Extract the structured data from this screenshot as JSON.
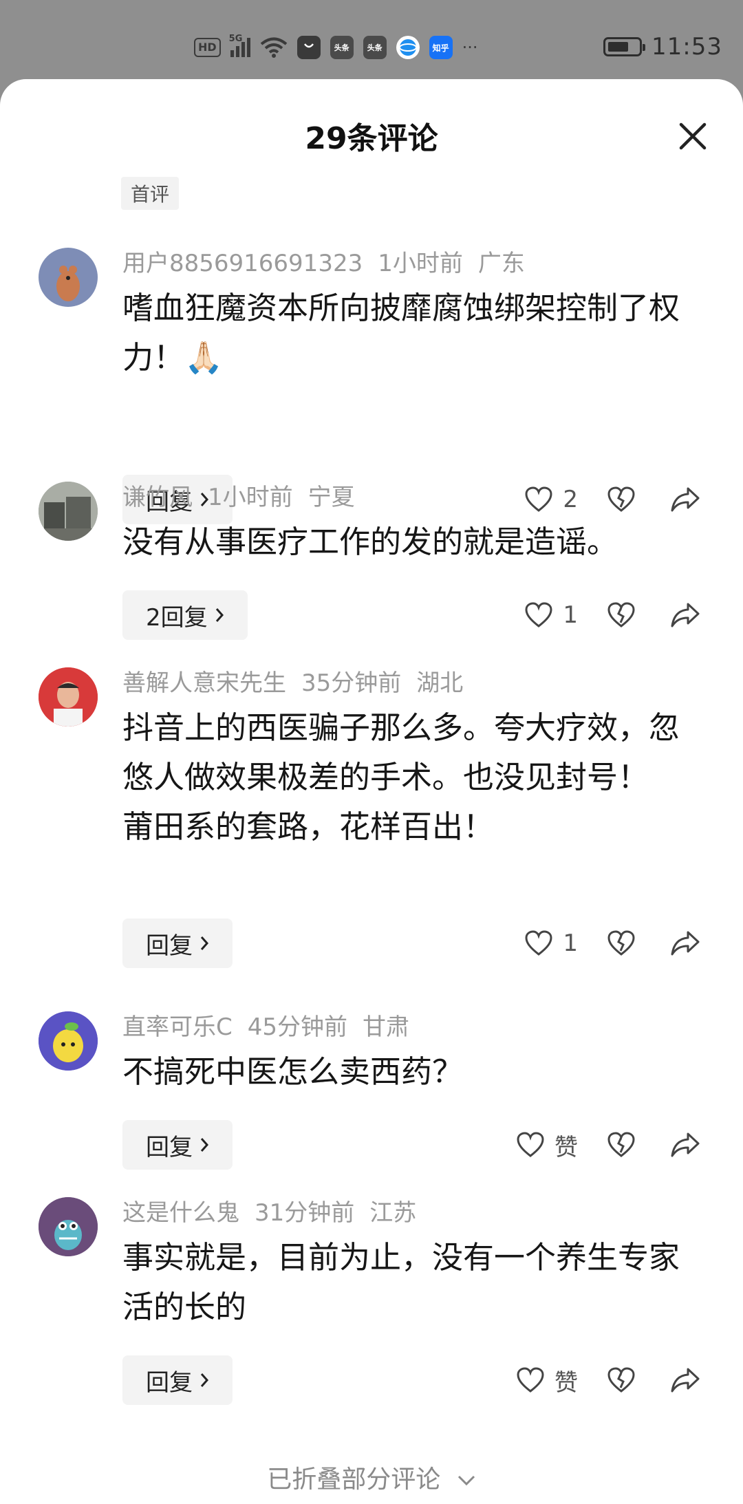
{
  "status": {
    "hd": "HD",
    "net": "5G",
    "mini1": "头条",
    "mini2": "头条",
    "mini3": "知乎",
    "more": "···",
    "time": "11:53",
    "battery_level": 0.7
  },
  "sheet": {
    "title": "29条评论",
    "first_tag": "首评",
    "collapsed": "已折叠部分评论"
  },
  "comments": [
    {
      "user": "用户8856916691323",
      "time": "1小时前",
      "region": "广东",
      "text": "嗜血狂魔资本所向披靡腐蚀绑架控制了权力！🙏🏻",
      "reply": "回复",
      "likes": "2"
    },
    {
      "user": "谦竹风",
      "time": "1小时前",
      "region": "宁夏",
      "text": "没有从事医疗工作的发的就是造谣。",
      "reply": "2回复",
      "likes": "1"
    },
    {
      "user": "善解人意宋先生",
      "time": "35分钟前",
      "region": "湖北",
      "text": "抖音上的西医骗子那么多。夸大疗效，忽悠人做效果极差的手术。也没见封号！\n莆田系的套路，花样百出！",
      "reply": "回复",
      "likes": "1"
    },
    {
      "user": "直率可乐C",
      "time": "45分钟前",
      "region": "甘肃",
      "text": "不搞死中医怎么卖西药？",
      "reply": "回复",
      "likes": "赞"
    },
    {
      "user": "这是什么鬼",
      "time": "31分钟前",
      "region": "江苏",
      "text": "事实就是，目前为止，没有一个养生专家活的长的",
      "reply": "回复",
      "likes": "赞"
    }
  ]
}
